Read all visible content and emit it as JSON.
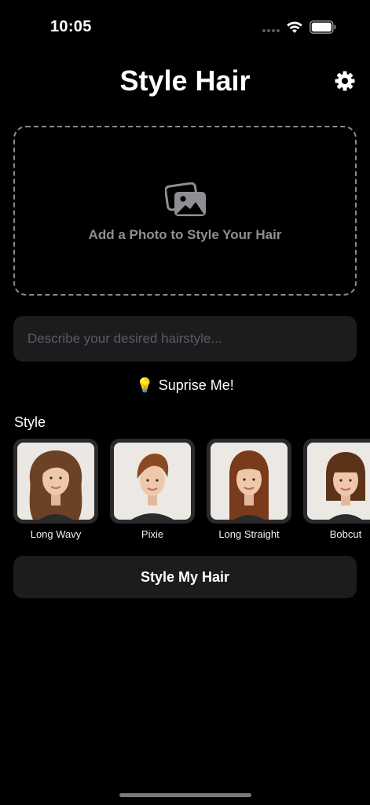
{
  "status_bar": {
    "time": "10:05",
    "icons": [
      "cellular-dots-icon",
      "wifi-icon",
      "battery-icon"
    ]
  },
  "header": {
    "title": "Style Hair",
    "settings_icon": "gear-icon"
  },
  "photo_upload": {
    "icon": "photo-stack-icon",
    "label": "Add a Photo to Style Your Hair"
  },
  "description": {
    "placeholder": "Describe your desired hairstyle...",
    "value": ""
  },
  "surprise": {
    "emoji": "💡",
    "label": "Suprise Me!"
  },
  "styles": {
    "section_label": "Style",
    "items": [
      {
        "name": "Long Wavy",
        "hair_color": "#6b4226"
      },
      {
        "name": "Pixie",
        "hair_color": "#8a4b22"
      },
      {
        "name": "Long Straight",
        "hair_color": "#7a3a1c"
      },
      {
        "name": "Bobcut",
        "hair_color": "#5c3319"
      }
    ]
  },
  "primary_action": {
    "label": "Style My Hair"
  },
  "colors": {
    "background": "#000000",
    "surface": "#1c1c1e",
    "muted_text": "#8e8e93"
  }
}
